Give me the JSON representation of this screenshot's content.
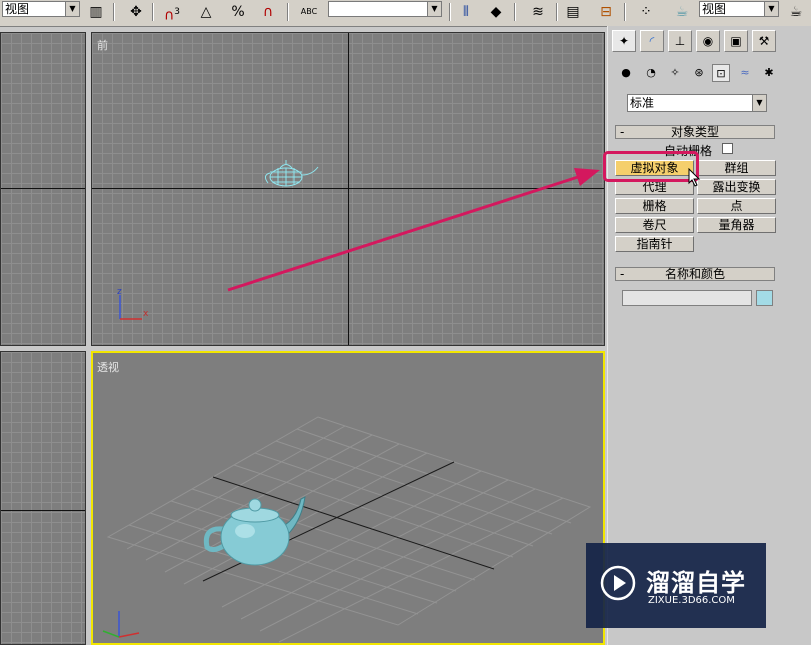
{
  "toolbar": {
    "view_dropdown_left": "视图",
    "view_dropdown_right": "视图",
    "snap_label": "3",
    "abc_label": "ABC",
    "name_selection_value": ""
  },
  "viewports": {
    "front_label": "前",
    "perspective_label": "透视",
    "axis_x": "x",
    "axis_z": "z",
    "active_border_color": "#f2e600"
  },
  "panel": {
    "category_dropdown": "标准",
    "object_type": {
      "header": "对象类型",
      "minus": "-",
      "auto_grid_label": "自动栅格",
      "buttons": [
        "虚拟对象",
        "群组",
        "代理",
        "露出变换",
        "栅格",
        "点",
        "卷尺",
        "量角器",
        "指南针"
      ]
    },
    "name_color": {
      "header": "名称和颜色",
      "minus": "-",
      "name_value": "",
      "swatch_color": "#a3dbe6"
    }
  },
  "watermark": {
    "title": "溜溜自学",
    "url": "ZIXUE.3D66.COM"
  },
  "colors": {
    "highlight_box": "#d4185e",
    "arrow": "#d4185e",
    "active_button": "#f5cf6c"
  }
}
